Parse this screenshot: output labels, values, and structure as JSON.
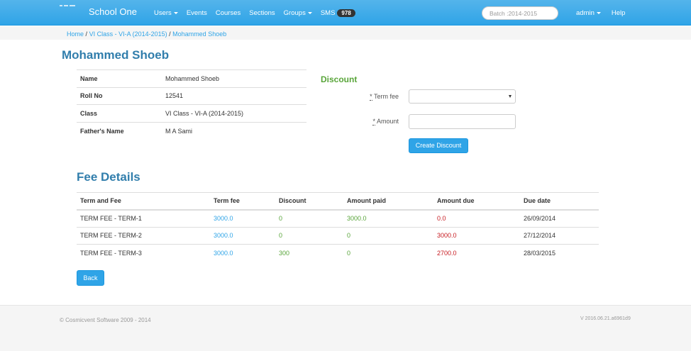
{
  "navbar": {
    "brand": "School One",
    "items": [
      {
        "label": "Users",
        "dropdown": true
      },
      {
        "label": "Events",
        "dropdown": false
      },
      {
        "label": "Courses",
        "dropdown": false
      },
      {
        "label": "Sections",
        "dropdown": false
      },
      {
        "label": "Groups",
        "dropdown": true
      }
    ],
    "sms_label": "SMS",
    "sms_count": "978",
    "batch_placeholder": "Batch :2014-2015",
    "admin_label": "admin",
    "help_label": "Help"
  },
  "breadcrumb": {
    "home": "Home",
    "class": "VI Class - VI-A (2014-2015)",
    "current": "Mohammed Shoeb",
    "separator": "/"
  },
  "page_title": "Mohammed Shoeb",
  "student_info": [
    {
      "label": "Name",
      "value": "Mohammed Shoeb"
    },
    {
      "label": "Roll No",
      "value": "12541"
    },
    {
      "label": "Class",
      "value": "VI Class - VI-A (2014-2015)"
    },
    {
      "label": "Father's Name",
      "value": "M A Sami"
    }
  ],
  "discount": {
    "title": "Discount",
    "term_fee_label": "Term fee",
    "amount_label": "Amount",
    "required_mark": "*",
    "submit_label": "Create Discount"
  },
  "fee_details": {
    "title": "Fee Details",
    "columns": [
      "Term and Fee",
      "Term fee",
      "Discount",
      "Amount paid",
      "Amount due",
      "Due date"
    ],
    "rows": [
      {
        "term": "TERM FEE - TERM-1",
        "term_fee": "3000.0",
        "discount": "0",
        "paid": "3000.0",
        "due": "0.0",
        "due_date": "26/09/2014"
      },
      {
        "term": "TERM FEE - TERM-2",
        "term_fee": "3000.0",
        "discount": "0",
        "paid": "0",
        "due": "3000.0",
        "due_date": "27/12/2014"
      },
      {
        "term": "TERM FEE - TERM-3",
        "term_fee": "3000.0",
        "discount": "300",
        "paid": "0",
        "due": "2700.0",
        "due_date": "28/03/2015"
      }
    ]
  },
  "back_label": "Back",
  "footer": {
    "copyright": "© Cosmicvent Software 2009 - 2014",
    "version": "V 2016.06.21.a6961d9"
  },
  "colors": {
    "primary": "#2fa4e7",
    "title": "#317eac",
    "success": "#59a53a",
    "danger": "#c71c22"
  }
}
